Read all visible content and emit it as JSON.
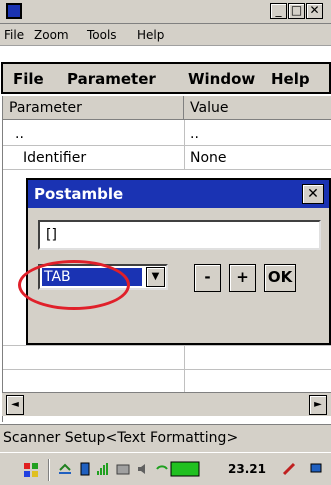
{
  "window": {
    "minimize": "_",
    "maximize": "□",
    "close": "✕"
  },
  "outer_menu": [
    "File",
    "Zoom",
    "Tools",
    "Help"
  ],
  "inner_menu": [
    "File",
    "Parameter",
    "Window",
    "Help"
  ],
  "list": {
    "columns": [
      "Parameter",
      "Value"
    ],
    "rows": [
      {
        "parameter": "..",
        "value": ".."
      },
      {
        "parameter": "Identifier",
        "value": "None"
      }
    ]
  },
  "dialog": {
    "title": "Postamble",
    "close": "✕",
    "input_value": "[]",
    "select_value": "TAB",
    "select_arrow": "▼",
    "buttons": {
      "minus": "-",
      "plus": "+",
      "ok": "OK"
    }
  },
  "scrollbar": {
    "left": "◄",
    "right": "►"
  },
  "status": "Scanner Setup<Text Formatting>",
  "taskbar": {
    "time": "23.21"
  },
  "annotation": {
    "color": "#e0202a"
  }
}
